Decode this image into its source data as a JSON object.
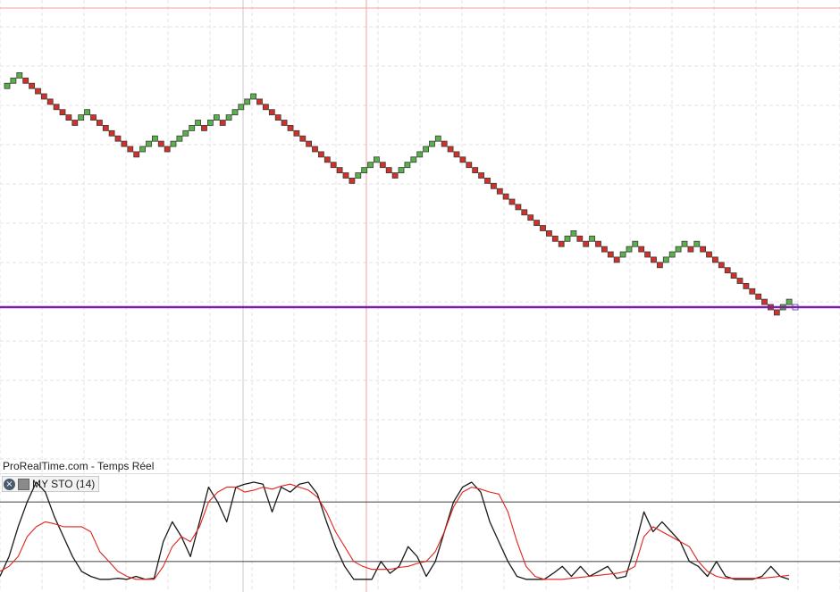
{
  "source_label": "ProRealTime.com - Temps Réel",
  "indicator": {
    "name": "MY STO (14)",
    "close_icon": "close-circle-icon",
    "settings_icon": "square-settings-icon"
  },
  "colors": {
    "up_brick": "#59b14a",
    "down_brick": "#d2312a",
    "level_line": "#7a1fa2",
    "stoch_fast": "#1a1a1a",
    "stoch_slow": "#e0231d",
    "osc_level": "#555555",
    "grid": "#e3e3e3",
    "cursor_red": "#f0a0a0",
    "cursor_gray": "#c8c8c8"
  },
  "chart_data": [
    {
      "type": "renko",
      "title": "",
      "directions": "UUUDDDDDDDDDUUDDDDDDDDUUUDDUUUUUDUUDUUUUUDDDDDDDDDDDDDDDDUUUUDDDUUUUUUUDDDDDDDDDDDDDDDDDDDDUUDDUDDDDUUUDDDDUUUUDUDDDDDDDDDDDDDUUD",
      "end_price_bricks": 0,
      "level_line_bricks": 0,
      "note_units": "bricks"
    },
    {
      "type": "line",
      "title": "",
      "ylim": [
        0,
        100
      ],
      "levels": [
        80,
        20
      ],
      "series": [
        {
          "name": "",
          "color": "#1a1a1a",
          "values": [
            5,
            25,
            55,
            80,
            100,
            90,
            65,
            45,
            25,
            10,
            5,
            2,
            2,
            3,
            2,
            5,
            2,
            3,
            40,
            60,
            45,
            25,
            60,
            95,
            80,
            60,
            95,
            98,
            100,
            98,
            70,
            95,
            90,
            98,
            100,
            88,
            60,
            35,
            15,
            2,
            2,
            2,
            20,
            8,
            15,
            35,
            25,
            5,
            20,
            50,
            80,
            95,
            100,
            90,
            60,
            40,
            20,
            5,
            2,
            2,
            2,
            8,
            15,
            5,
            15,
            5,
            10,
            15,
            3,
            5,
            35,
            70,
            50,
            60,
            50,
            40,
            20,
            15,
            5,
            20,
            5,
            2,
            2,
            2,
            5,
            15,
            5,
            2
          ]
        },
        {
          "name": "",
          "color": "#e0231d",
          "values": [
            10,
            15,
            25,
            45,
            55,
            60,
            58,
            55,
            55,
            55,
            50,
            30,
            20,
            10,
            5,
            2,
            2,
            2,
            15,
            35,
            45,
            40,
            55,
            80,
            90,
            95,
            95,
            90,
            92,
            95,
            93,
            96,
            98,
            95,
            92,
            85,
            70,
            50,
            35,
            20,
            15,
            12,
            12,
            12,
            14,
            15,
            18,
            20,
            30,
            50,
            75,
            90,
            95,
            93,
            90,
            88,
            70,
            40,
            15,
            5,
            2,
            2,
            2,
            3,
            4,
            5,
            6,
            7,
            8,
            10,
            15,
            45,
            55,
            50,
            45,
            40,
            35,
            20,
            10,
            5,
            3,
            3,
            3,
            3,
            3,
            4,
            5,
            6
          ]
        }
      ]
    }
  ]
}
